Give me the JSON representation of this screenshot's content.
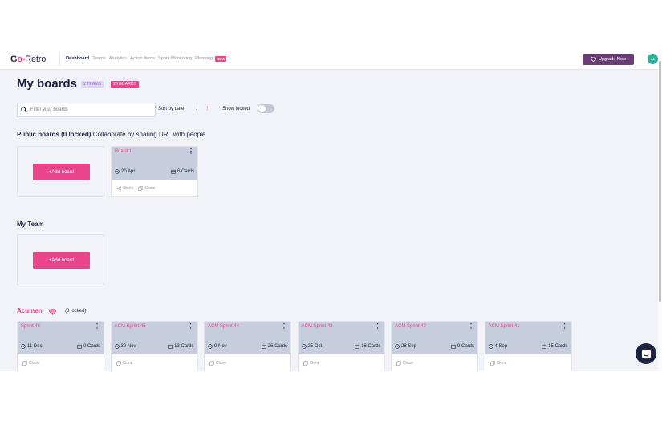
{
  "nav": {
    "logo": {
      "go": "G",
      "o": "o",
      "r": "R",
      "etro": "etro"
    },
    "items": [
      "Dashboard",
      "Teams",
      "Analytics",
      "Action Items",
      "Sprint Monitoring",
      "Planning"
    ],
    "new_badge": "NEW",
    "upgrade_label": "Upgrade Now",
    "avatar_initials": "AL"
  },
  "header": {
    "title": "My boards",
    "teams_badge": "2 TEAMS",
    "boards_badge": "28 BOARDS"
  },
  "filters": {
    "search_placeholder": "Filter your boards",
    "sort_label": "Sort by date",
    "show_locked_label": "Show locked",
    "show_locked": false
  },
  "public": {
    "title": "Public boards (0 locked)",
    "subtitle": "Collaborate by sharing URL with people",
    "add_label": "+Add board",
    "boards": [
      {
        "name": "Board 1",
        "date": "20 Apr",
        "cards": "6 Cards",
        "share": "Share",
        "clone": "Clone"
      }
    ]
  },
  "myteam": {
    "title": "My Team",
    "add_label": "+Add board"
  },
  "acumen": {
    "title": "Acumen",
    "locked": "(3 locked)",
    "boards": [
      {
        "name": "Sprint 46",
        "date": "11 Dec",
        "cards": "0 Cards",
        "clone": "Clone"
      },
      {
        "name": "ACM Sprint 45",
        "date": "30 Nov",
        "cards": "13 Cards",
        "clone": "Clone"
      },
      {
        "name": "ACM Sprint 44",
        "date": "9 Nov",
        "cards": "26 Cards",
        "clone": "Clone"
      },
      {
        "name": "ACM Sprint 43",
        "date": "25 Oct",
        "cards": "16 Cards",
        "clone": "Clone"
      },
      {
        "name": "ACM Sprint 42",
        "date": "28 Sep",
        "cards": "9 Cards",
        "clone": "Clone"
      },
      {
        "name": "ACM Sprint 41",
        "date": "4 Sep",
        "cards": "15 Cards",
        "clone": "Clone"
      }
    ]
  },
  "colors": {
    "accent": "#e8458b",
    "upgrade": "#6b3d78",
    "navy": "#1c2341",
    "card_head": "#c6cedd"
  }
}
